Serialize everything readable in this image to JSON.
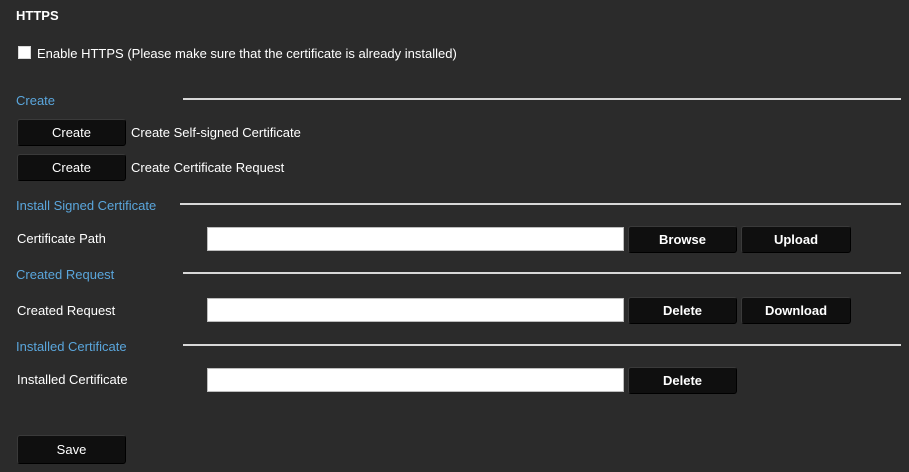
{
  "title": "HTTPS",
  "enable": {
    "label": "Enable  HTTPS (Please make sure that the certificate is already installed)",
    "checked": false
  },
  "create_section": {
    "label": "Create",
    "rows": [
      {
        "button": "Create",
        "text": "Create Self-signed Certificate"
      },
      {
        "button": "Create",
        "text": "Create Certificate Request"
      }
    ]
  },
  "install_section": {
    "label": "Install Signed Certificate",
    "field_label": "Certificate Path",
    "field_value": "",
    "browse": "Browse",
    "upload": "Upload"
  },
  "request_section": {
    "label": "Created Request",
    "field_label": "Created Request",
    "field_value": "",
    "delete": "Delete",
    "download": "Download"
  },
  "installed_section": {
    "label": "Installed Certificate",
    "field_label": "Installed Certificate",
    "field_value": "",
    "delete": "Delete"
  },
  "save": "Save",
  "colors": {
    "background": "#2b2b2b",
    "section_label": "#5aa6dc",
    "divider": "#d8d8d8",
    "button": "#0f0f0f"
  }
}
